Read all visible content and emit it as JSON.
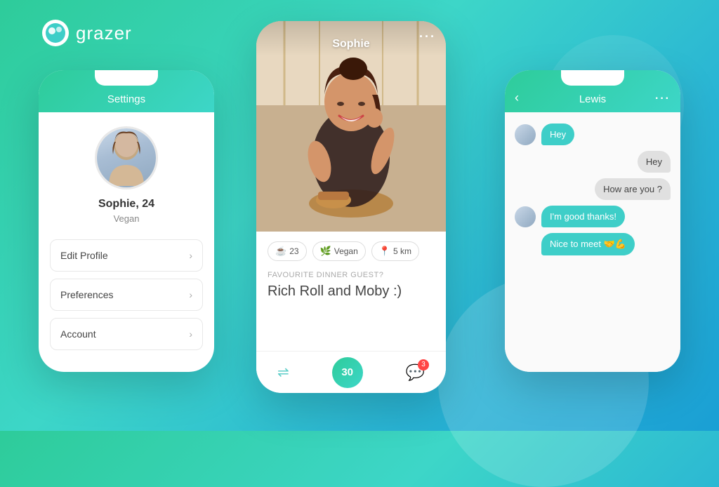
{
  "app": {
    "name": "grazer"
  },
  "leftPhone": {
    "title": "Settings",
    "user": {
      "name": "Sophie, 24",
      "tag": "Vegan"
    },
    "menuItems": [
      {
        "label": "Edit Profile"
      },
      {
        "label": "Preferences"
      },
      {
        "label": "Account"
      }
    ]
  },
  "centerPhone": {
    "profileName": "Sophie",
    "dotsLabel": "···",
    "badges": [
      {
        "icon": "☕",
        "text": "23"
      },
      {
        "icon": "🌿",
        "text": "Vegan"
      },
      {
        "icon": "📍",
        "text": "5 km"
      }
    ],
    "favLabel": "FAVOURITE DINNER GUEST?",
    "favValue": "Rich Roll and Moby :)",
    "bottomCount": "30",
    "chatBadge": "3"
  },
  "rightPhone": {
    "title": "Lewis",
    "dotsLabel": "···",
    "messages": [
      {
        "type": "received",
        "text": "Hey",
        "hasAvatar": true
      },
      {
        "type": "sent",
        "text": "Hey"
      },
      {
        "type": "sent",
        "text": "How are you ?"
      },
      {
        "type": "received",
        "text": "I'm good thanks!",
        "hasAvatar": true
      },
      {
        "type": "received",
        "text": "Nice to meet 🤝💪",
        "hasAvatar": false
      }
    ]
  },
  "colors": {
    "teal": "#3ecec8",
    "tealDark": "#2ecc9a",
    "white": "#ffffff"
  }
}
